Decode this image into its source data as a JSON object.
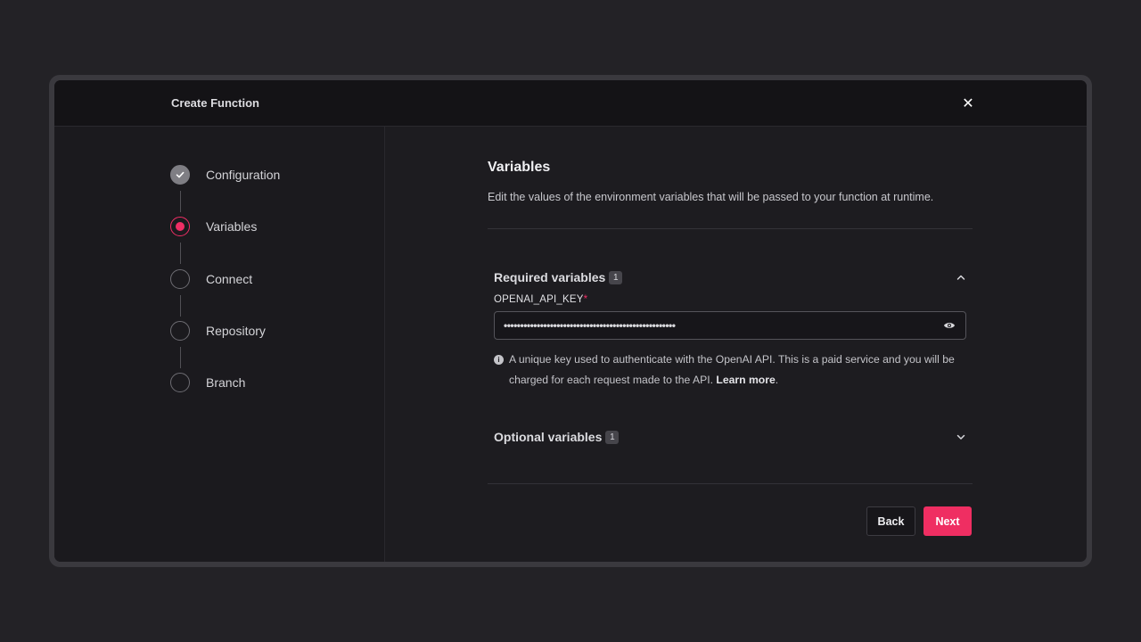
{
  "modal": {
    "title": "Create Function",
    "close_icon": "close-icon"
  },
  "steps": [
    {
      "label": "Configuration",
      "state": "done"
    },
    {
      "label": "Variables",
      "state": "active"
    },
    {
      "label": "Connect",
      "state": "pending"
    },
    {
      "label": "Repository",
      "state": "pending"
    },
    {
      "label": "Branch",
      "state": "pending"
    }
  ],
  "content": {
    "title": "Variables",
    "description": "Edit the values of the environment variables that will be passed to your function at runtime."
  },
  "required": {
    "title": "Required variables",
    "count": "1",
    "expanded": true,
    "field": {
      "label": "OPENAI_API_KEY",
      "required_marker": "*",
      "value": "••••••••••••••••••••••••••••••••••••••••••••••••••••",
      "hint_text": "A unique key used to authenticate with the OpenAI API. This is a paid service and you will be charged for each request made to the API.",
      "hint_link": "Learn more",
      "hint_end": "."
    }
  },
  "optional": {
    "title": "Optional variables",
    "count": "1",
    "expanded": false
  },
  "buttons": {
    "back": "Back",
    "next": "Next"
  },
  "colors": {
    "accent": "#f02e65",
    "background": "#232226",
    "modal": "#1d1c20"
  }
}
